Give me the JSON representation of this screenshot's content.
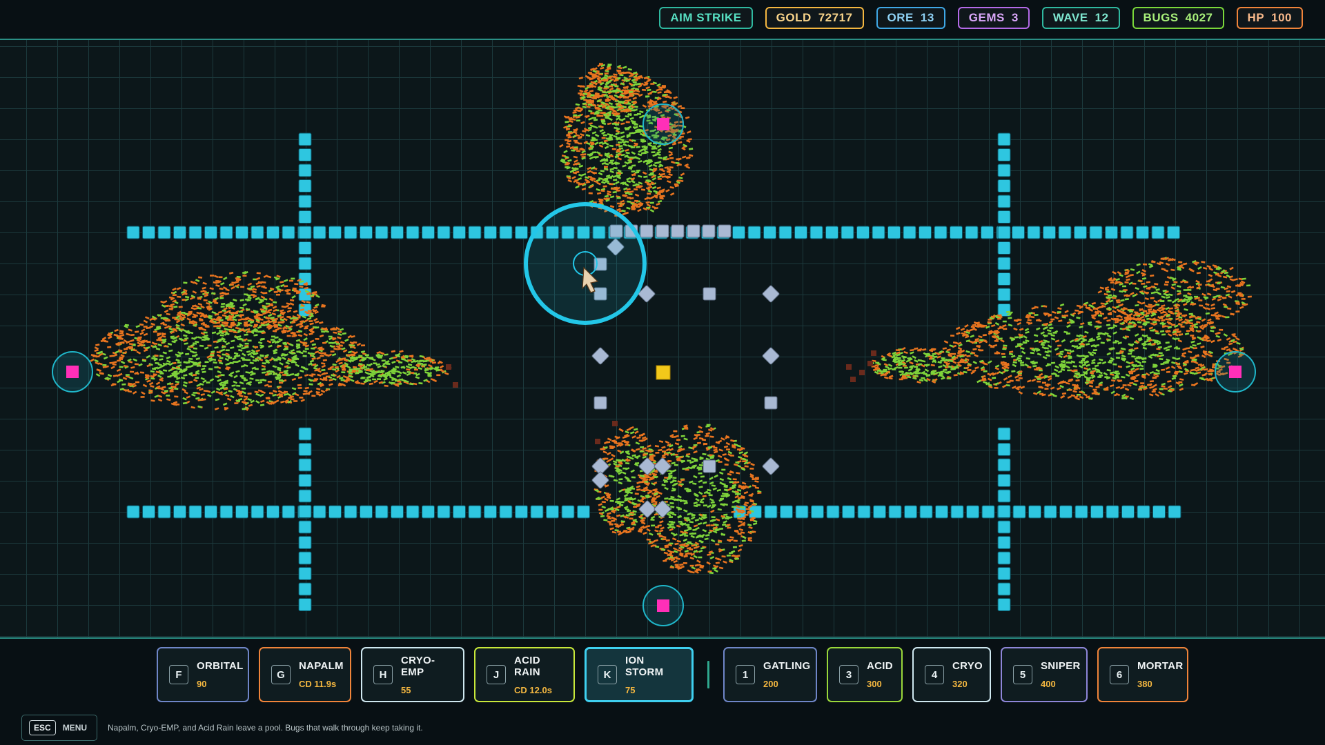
{
  "hud": {
    "chips": [
      {
        "id": "aim-strike",
        "label": "AIM STRIKE",
        "value": "",
        "color": "#2fb89f",
        "text": "#57e0c3"
      },
      {
        "id": "gold",
        "label": "GOLD",
        "value": "72717",
        "color": "#f4b740",
        "text": "#f8d48a"
      },
      {
        "id": "ore",
        "label": "ORE",
        "value": "13",
        "color": "#3fa8e6",
        "text": "#8fd2f5"
      },
      {
        "id": "gems",
        "label": "GEMS",
        "value": "3",
        "color": "#b46ae8",
        "text": "#dba8fb"
      },
      {
        "id": "wave",
        "label": "WAVE",
        "value": "12",
        "color": "#2fb89f",
        "text": "#7fe7d0"
      },
      {
        "id": "bugs",
        "label": "BUGS",
        "value": "4027",
        "color": "#7bd83a",
        "text": "#a8f07a"
      },
      {
        "id": "hp",
        "label": "HP",
        "value": "100",
        "color": "#f0843a",
        "text": "#f7b88a"
      }
    ]
  },
  "abilities": [
    {
      "id": "orbital",
      "key": "F",
      "name": "ORBITAL",
      "sub": "90",
      "color": "#6f86c8",
      "active": false
    },
    {
      "id": "napalm",
      "key": "G",
      "name": "NAPALM",
      "sub": "CD  11.9s",
      "color": "#f0843a",
      "active": false
    },
    {
      "id": "cryo-emp",
      "key": "H",
      "name": "CRYO-EMP",
      "sub": "55",
      "color": "#cfe8f0",
      "active": false
    },
    {
      "id": "acid-rain",
      "key": "J",
      "name": "ACID RAIN",
      "sub": "CD  12.0s",
      "color": "#c8e83a",
      "active": false
    },
    {
      "id": "ion-storm",
      "key": "K",
      "name": "ION STORM",
      "sub": "75",
      "color": "#3fd0f0",
      "active": true
    }
  ],
  "turrets": [
    {
      "id": "gatling",
      "key": "1",
      "name": "GATLING",
      "sub": "200",
      "color": "#6f86c8"
    },
    {
      "id": "acid",
      "key": "3",
      "name": "ACID",
      "sub": "300",
      "color": "#9ad83a"
    },
    {
      "id": "cryo",
      "key": "4",
      "name": "CRYO",
      "sub": "320",
      "color": "#cfe8f0"
    },
    {
      "id": "sniper",
      "key": "5",
      "name": "SNIPER",
      "sub": "400",
      "color": "#8e86d8"
    },
    {
      "id": "mortar",
      "key": "6",
      "name": "MORTAR",
      "sub": "380",
      "color": "#f0843a"
    }
  ],
  "menu": {
    "key": "ESC",
    "label": "MENU"
  },
  "hint": "Napalm, Cryo-EMP, and Acid Rain leave a pool. Bugs that walk through keep taking it.",
  "colors": {
    "wall": "#2ec6e0",
    "bug_orange": "#e8741f",
    "bug_green": "#7ed33a",
    "spawner": "#ff2fb8",
    "core": "#f2c81a",
    "turret": "#a9b9d3",
    "ion_ring": "#23c7e8"
  }
}
